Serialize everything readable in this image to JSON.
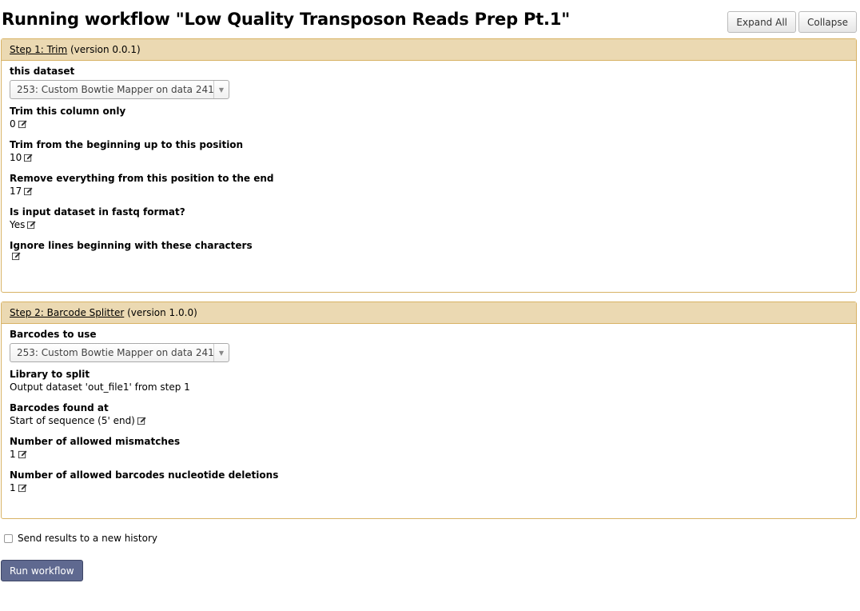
{
  "title": "Running workflow \"Low Quality Transposon Reads Prep Pt.1\"",
  "toolbar": {
    "expand_all": "Expand All",
    "collapse": "Collapse"
  },
  "steps": [
    {
      "step_label": "Step 1: Trim",
      "version": "(version 0.0.1)",
      "dataset_label": "this dataset",
      "dataset_select": "253: Custom Bowtie Mapper on data 241",
      "fields": [
        {
          "label": "Trim this column only",
          "value": "0"
        },
        {
          "label": "Trim from the beginning up to this position",
          "value": "10"
        },
        {
          "label": "Remove everything from this position to the end",
          "value": "17"
        },
        {
          "label": "Is input dataset in fastq format?",
          "value": "Yes"
        },
        {
          "label": "Ignore lines beginning with these characters",
          "value": ""
        }
      ]
    },
    {
      "step_label": "Step 2: Barcode Splitter",
      "version": "(version 1.0.0)",
      "dataset_label": "Barcodes to use",
      "dataset_select": "253: Custom Bowtie Mapper on data 241",
      "library_label": "Library to split",
      "library_value": "Output dataset 'out_file1' from step 1",
      "fields": [
        {
          "label": "Barcodes found at",
          "value": "Start of sequence (5' end)"
        },
        {
          "label": "Number of allowed mismatches",
          "value": "1"
        },
        {
          "label": "Number of allowed barcodes nucleotide deletions",
          "value": "1"
        }
      ]
    }
  ],
  "history": {
    "label": "Send results to a new history",
    "checked": false
  },
  "run_button": "Run workflow",
  "colors": {
    "step_header": "#ebd9b2",
    "step_border": "#d8b365",
    "run_button": "#5f6990"
  },
  "icons": {
    "edit": "edit-icon",
    "select_arrow": "chevron-down-icon"
  }
}
